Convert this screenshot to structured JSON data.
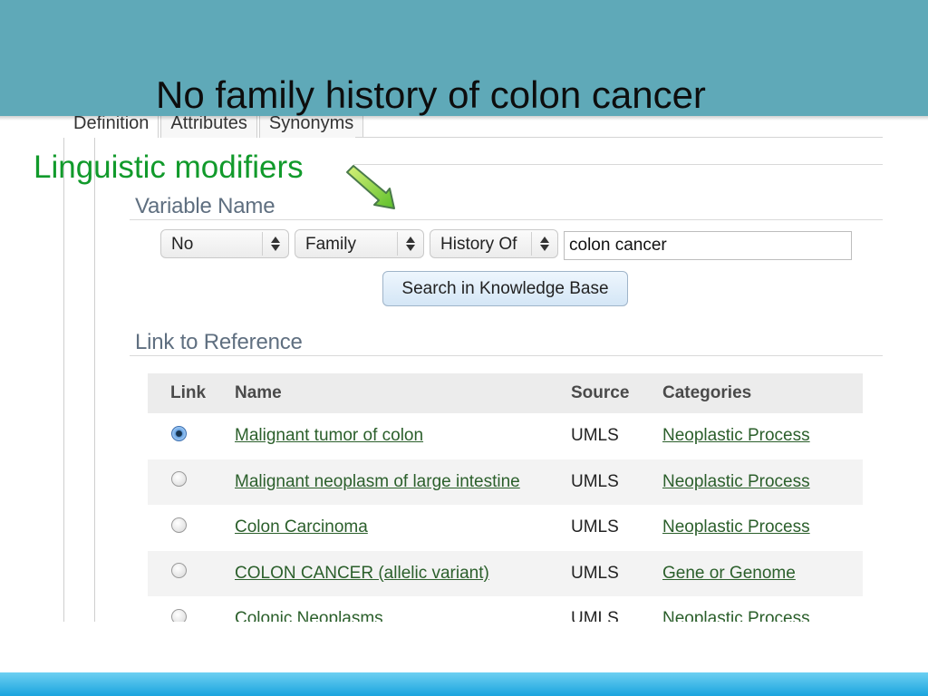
{
  "slide": {
    "title": "No family history of colon cancer",
    "annotation": "Linguistic modifiers",
    "banner_color": "#5fa9b8",
    "annotation_color": "#119a2b",
    "footer_color": "#1aa4de"
  },
  "tabs": [
    "Definition",
    "Attributes",
    "Synonyms"
  ],
  "variable_name": {
    "title": "Variable Name",
    "selects": [
      "No",
      "Family",
      "History Of"
    ],
    "term_value": "colon cancer",
    "search_button": "Search in Knowledge Base"
  },
  "reference": {
    "title": "Link to Reference",
    "columns": [
      "Link",
      "Name",
      "Source",
      "Categories"
    ],
    "rows": [
      {
        "selected": true,
        "name": "Malignant tumor of colon",
        "source": "UMLS",
        "category": "Neoplastic Process"
      },
      {
        "selected": false,
        "name": "Malignant neoplasm of large intestine",
        "source": "UMLS",
        "category": "Neoplastic Process"
      },
      {
        "selected": false,
        "name": "Colon Carcinoma",
        "source": "UMLS",
        "category": "Neoplastic Process"
      },
      {
        "selected": false,
        "name": "COLON CANCER (allelic variant)",
        "source": "UMLS",
        "category": "Gene or Genome"
      },
      {
        "selected": false,
        "name": "Colonic Neoplasms",
        "source": "UMLS",
        "category": "Neoplastic Process"
      }
    ]
  }
}
